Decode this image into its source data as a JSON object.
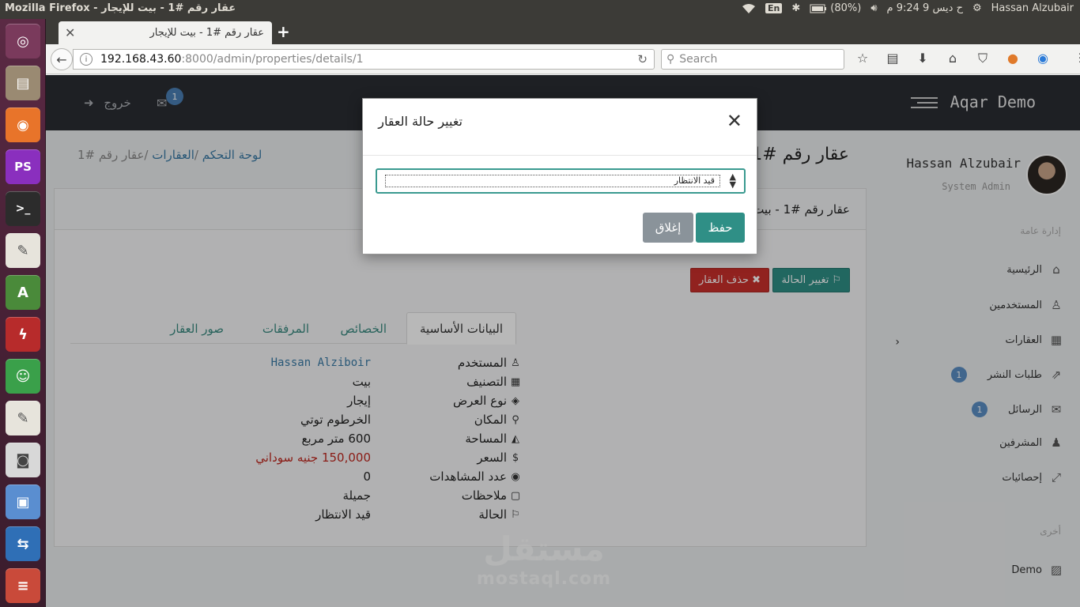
{
  "os_topbar": {
    "window_title": "Mozilla Firefox - عقار رقم #1 - بيت للإيجار",
    "keyboard_layout": "En",
    "battery": "(80%)",
    "clock": "ح ديس  9 9:24 م",
    "user": "Hassan Alzubair"
  },
  "launcher": {
    "items": [
      "ubuntu-icon",
      "files-icon",
      "firefox-icon",
      "phpstorm-icon",
      "terminal-icon",
      "text-editor-icon",
      "android-studio-icon",
      "filezilla-icon",
      "game-icon",
      "text-editor-2-icon",
      "camera-icon",
      "virtualbox-icon",
      "teamviewer-icon",
      "stack-icon"
    ]
  },
  "browser": {
    "tab_title": "عقار رقم #1 - بيت للإيجار",
    "url_host": "192.168.43.60",
    "url_path": ":8000/admin/properties/details/1",
    "search_placeholder": "Search"
  },
  "app": {
    "logo": "Aqar Demo",
    "logout_label": "خروج",
    "messages_count": "1",
    "profile_name": "Hassan Alzubair",
    "profile_role": "System Admin",
    "sidebar": {
      "section_general": "إدارة عامة",
      "items": [
        {
          "label": "الرئيسية",
          "icon": "home-icon"
        },
        {
          "label": "المستخدمين",
          "icon": "user-icon"
        },
        {
          "label": "العقارات",
          "icon": "building-icon"
        },
        {
          "label": "طلبات النشر",
          "icon": "share-icon",
          "badge": "1"
        },
        {
          "label": "الرسائل",
          "icon": "envelope-icon",
          "badge": "1"
        },
        {
          "label": "المشرفين",
          "icon": "users-icon"
        },
        {
          "label": "إحصائيات",
          "icon": "chart-icon"
        }
      ],
      "section_other": "أخرى",
      "demo_label": "Demo"
    },
    "page_title": "عقار رقم #1 - بيت",
    "breadcrumb": {
      "home": "لوحة التحكم",
      "properties": "العقارات",
      "current": "عقار رقم #1"
    },
    "card_title": "عقار رقم #1 - بيت",
    "buttons": {
      "change_status": "تغيير الحالة",
      "delete": "حذف العقار"
    },
    "tabs": [
      "البيانات الأساسية",
      "الخصائص",
      "المرفقات",
      "صور العقار"
    ],
    "details": [
      {
        "label": "المستخدم",
        "value": "Hassan Alziboir",
        "icon": "user-icon"
      },
      {
        "label": "التصنيف",
        "value": "بيت",
        "icon": "building-icon"
      },
      {
        "label": "نوع العرض",
        "value": "إيجار",
        "icon": "tags-icon"
      },
      {
        "label": "المكان",
        "value": "الخرطوم توتي",
        "icon": "map-marker-icon"
      },
      {
        "label": "المساحة",
        "value": "600 متر مربع",
        "icon": "area-chart-icon"
      },
      {
        "label": "السعر",
        "value": "150,000 جنيه سوداني",
        "icon": "dollar-icon"
      },
      {
        "label": "عدد المشاهدات",
        "value": "0",
        "icon": "eye-icon"
      },
      {
        "label": "ملاحظات",
        "value": "جميلة",
        "icon": "note-icon"
      },
      {
        "label": "الحالة",
        "value": "قيد الانتظار",
        "icon": "flag-icon"
      }
    ],
    "watermark": {
      "arabic": "مستقل",
      "latin": "mostaql.com"
    }
  },
  "modal": {
    "title": "تغيير حالة العقار",
    "select_value": "قيد الانتظار",
    "save_label": "حفظ",
    "close_label": "إغلاق"
  },
  "colors": {
    "primary": "#2f8f86",
    "danger": "#c9302c",
    "header_bg": "#2a2d33",
    "link": "#3a7aa6"
  }
}
